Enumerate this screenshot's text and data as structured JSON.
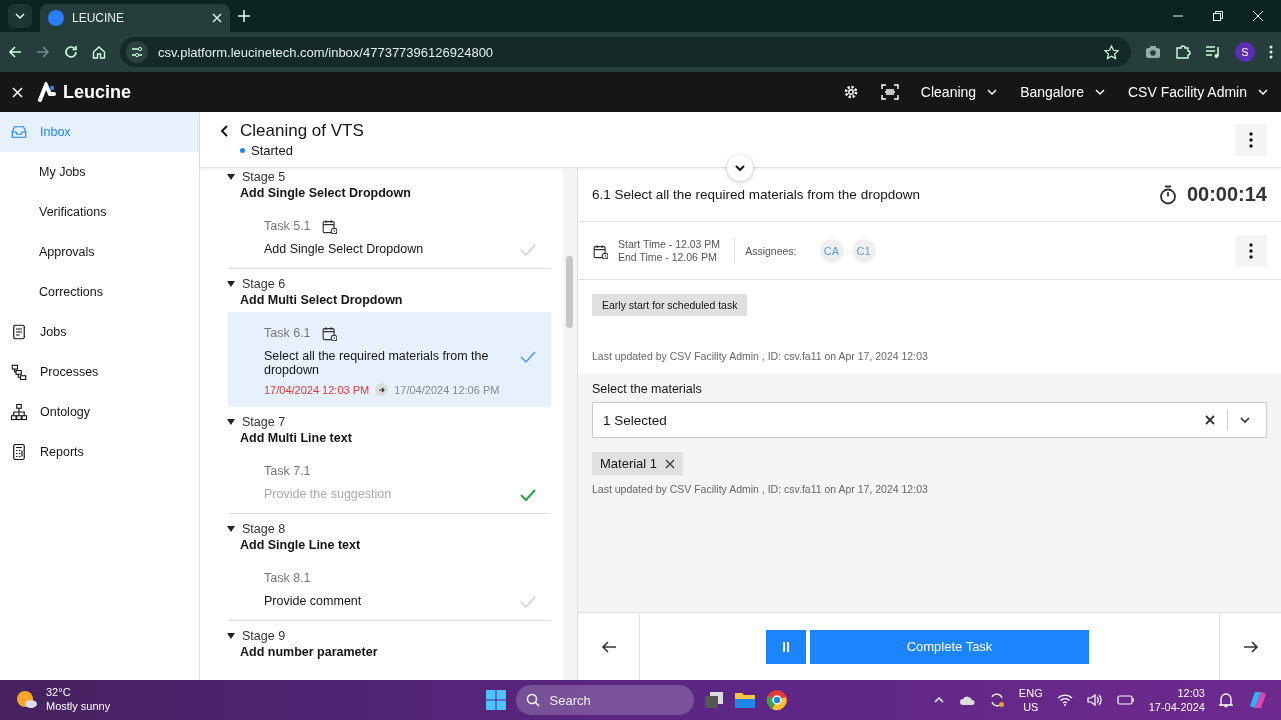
{
  "browser": {
    "tab_title": "LEUCINE",
    "url": "csv.platform.leucinetech.com/inbox/477377396126924800",
    "profile_initial": "S"
  },
  "app_header": {
    "brand": "Leucine",
    "menus": [
      "Cleaning",
      "Bangalore",
      "CSV Facility Admin"
    ]
  },
  "sidebar": {
    "items": [
      {
        "label": "Inbox",
        "kind": "main",
        "selected": true
      },
      {
        "label": "My Jobs",
        "kind": "sub",
        "selected": false
      },
      {
        "label": "Verifications",
        "kind": "sub",
        "selected": false
      },
      {
        "label": "Approvals",
        "kind": "sub",
        "selected": false
      },
      {
        "label": "Corrections",
        "kind": "sub",
        "selected": false
      },
      {
        "label": "Jobs",
        "kind": "main",
        "selected": false
      },
      {
        "label": "Processes",
        "kind": "main",
        "selected": false
      },
      {
        "label": "Ontology",
        "kind": "main",
        "selected": false
      },
      {
        "label": "Reports",
        "kind": "main",
        "selected": false
      }
    ]
  },
  "job": {
    "title": "Cleaning of VTS",
    "status": "Started"
  },
  "stages": [
    {
      "label": "Stage 5",
      "name": "Add Single Select Dropdown",
      "expanded": true,
      "tasks": [
        {
          "label": "Task 5.1",
          "name": "Add Single Select Dropdown",
          "scheduled": true,
          "selected": false,
          "completed": false
        }
      ]
    },
    {
      "label": "Stage 6",
      "name": "Add Multi Select Dropdown",
      "expanded": true,
      "tasks": [
        {
          "label": "Task 6.1",
          "name": "Select all the required materials from the dropdown",
          "scheduled": true,
          "selected": true,
          "completed": false,
          "start": "17/04/2024 12:03 PM",
          "end": "17/04/2024 12:06 PM"
        }
      ]
    },
    {
      "label": "Stage 7",
      "name": "Add Multi Line text",
      "expanded": true,
      "tasks": [
        {
          "label": "Task 7.1",
          "name": "Provide the suggestion",
          "scheduled": false,
          "selected": false,
          "completed": true
        }
      ]
    },
    {
      "label": "Stage 8",
      "name": "Add Single Line text",
      "expanded": true,
      "tasks": [
        {
          "label": "Task 8.1",
          "name": "Provide comment",
          "scheduled": false,
          "selected": false,
          "completed": false
        }
      ]
    },
    {
      "label": "Stage 9",
      "name": "Add number parameter",
      "expanded": true
    }
  ],
  "task_detail": {
    "title": "6.1 Select all the required materials from the dropdown",
    "timer": "00:00:14",
    "start_time": "Start Time - 12.03 PM",
    "end_time": "End Time - 12.06 PM",
    "assignees_label": "Assignees:",
    "assignees": [
      "CA",
      "C1"
    ],
    "badge": "Early start for scheduled task",
    "last_updated": "Last updated by CSV Facility Admin , ID: csv.fa11 on Apr 17, 2024 12:03",
    "parameter": {
      "label": "Select the materials",
      "value": "1 Selected",
      "chips": [
        "Material 1"
      ],
      "last_updated": "Last updated by CSV Facility Admin , ID: csv.fa11 on Apr 17, 2024 12:03"
    }
  },
  "footer": {
    "primary_button": "Complete Task"
  },
  "taskbar": {
    "temperature": "32°C",
    "weather": "Mostly sunny",
    "search_placeholder": "Search",
    "language": "ENG",
    "region": "US",
    "time": "12:03",
    "date": "17-04-2024"
  }
}
